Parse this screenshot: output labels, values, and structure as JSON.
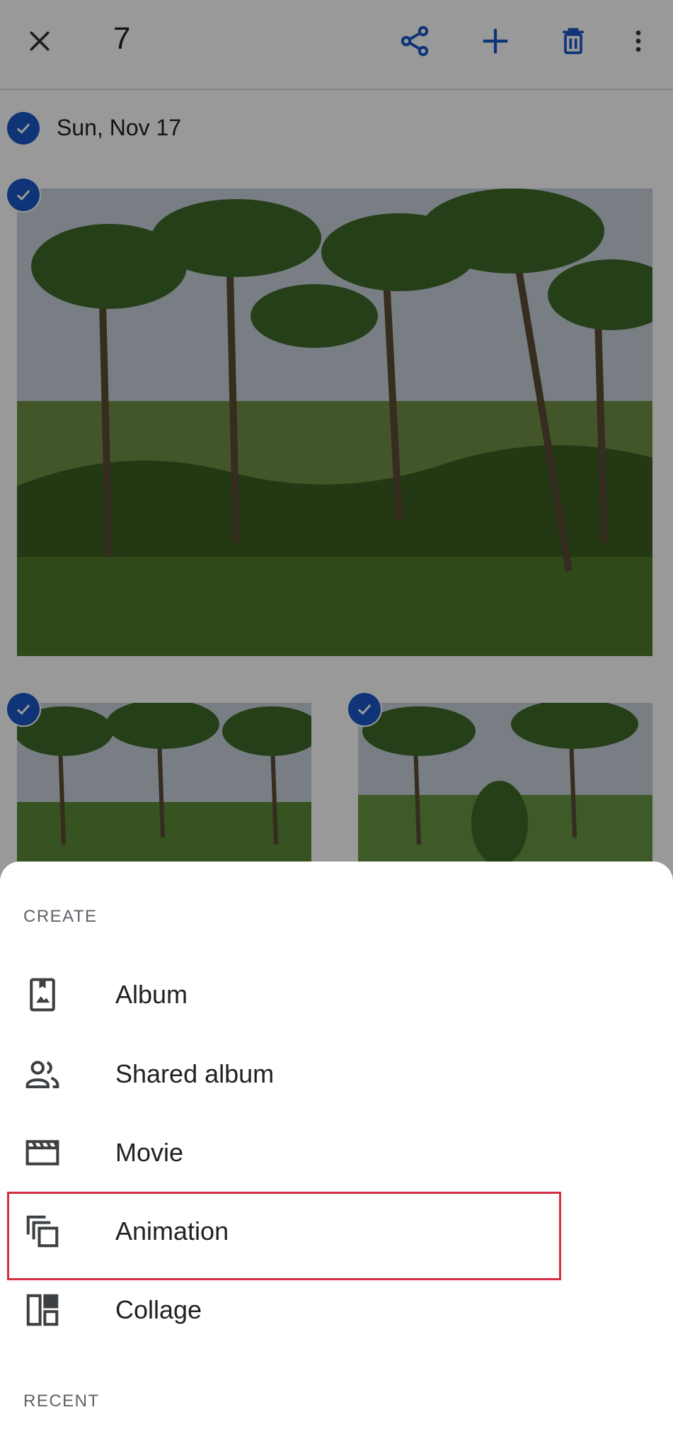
{
  "header": {
    "selected_count": "7",
    "actions": [
      "close-icon",
      "share-icon",
      "add-icon",
      "delete-icon",
      "more-vert-icon"
    ]
  },
  "date_group": {
    "label": "Sun, Nov 17"
  },
  "sheet": {
    "create_header": "CREATE",
    "items": [
      {
        "label": "Album",
        "icon": "album-icon"
      },
      {
        "label": "Shared album",
        "icon": "shared-album-icon"
      },
      {
        "label": "Movie",
        "icon": "movie-icon"
      },
      {
        "label": "Animation",
        "icon": "animation-icon"
      },
      {
        "label": "Collage",
        "icon": "collage-icon"
      }
    ],
    "recent_header": "RECENT",
    "highlighted_item": "Animation"
  },
  "colors": {
    "accent": "#1a57c9",
    "highlight": "#d32f3f",
    "text_primary": "#202124",
    "text_secondary": "#5f6368"
  }
}
